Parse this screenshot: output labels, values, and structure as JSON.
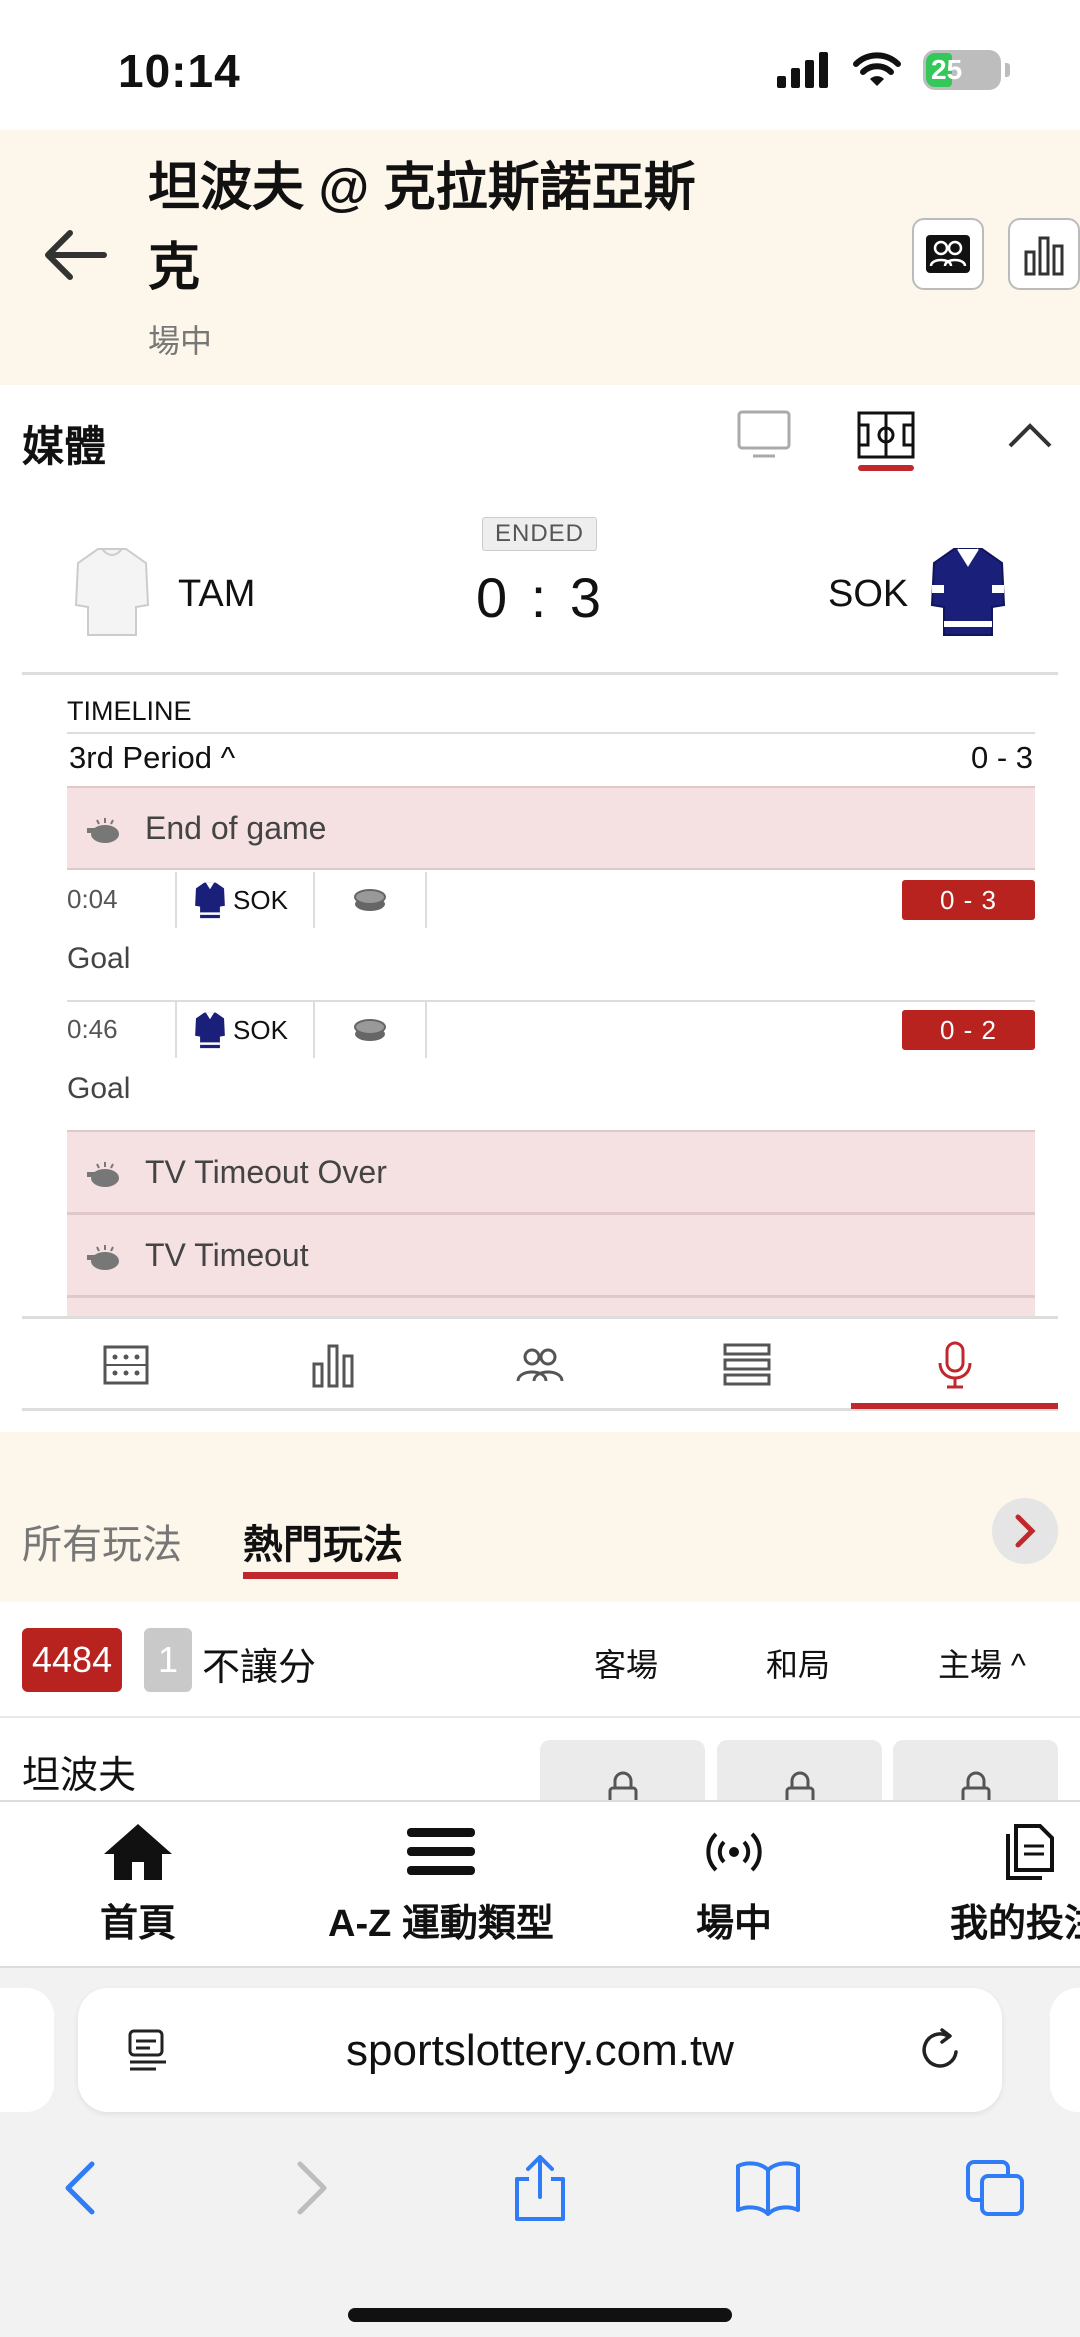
{
  "status_bar": {
    "time": "10:14",
    "battery": "25"
  },
  "header": {
    "title": "坦波夫 @ 克拉斯諾亞斯克",
    "subtitle": "場中"
  },
  "media": {
    "title": "媒體"
  },
  "scoreboard": {
    "status": "ENDED",
    "home_team": "TAM",
    "away_team": "SOK",
    "score": "0 : 3"
  },
  "timeline": {
    "label": "TIMELINE",
    "period": "3rd Period ^",
    "period_score": "0 - 3",
    "events": [
      {
        "text": "End of game"
      },
      {
        "time": "0:04",
        "team": "SOK",
        "score": "0 - 3",
        "label": "Goal"
      },
      {
        "time": "0:46",
        "team": "SOK",
        "score": "0 - 2",
        "label": "Goal"
      },
      {
        "text": "TV Timeout Over"
      },
      {
        "text": "TV Timeout"
      }
    ]
  },
  "bet_tabs": {
    "all": "所有玩法",
    "popular": "熱門玩法"
  },
  "market": {
    "id": "4484",
    "num": "1",
    "name": "不讓分",
    "col_away": "客場",
    "col_draw": "和局",
    "col_home": "主場 ^"
  },
  "team_row": {
    "name": "坦波夫"
  },
  "bottom_nav": {
    "home": "首頁",
    "sports": "A-Z 運動類型",
    "live": "場中",
    "mybets": "我的投注"
  },
  "browser": {
    "url": "sportslottery.com.tw"
  },
  "colors": {
    "accent": "#c0282d",
    "header_bg": "#fcf7ea",
    "event_bg": "#f6e1e2",
    "score_badge": "#b8221f"
  }
}
